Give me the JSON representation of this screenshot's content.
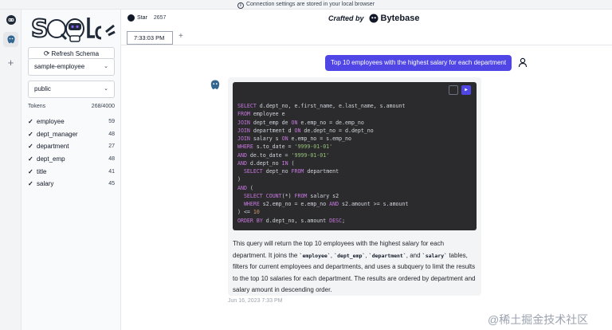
{
  "banner": {
    "text": "Connection settings are stored in your local browser",
    "icon": "info-icon"
  },
  "github": {
    "label": "Star",
    "count": "2657"
  },
  "header": {
    "crafted": "Crafted by",
    "brand": "Bytebase"
  },
  "tab": {
    "label": "7:33:03 PM",
    "add": "+"
  },
  "sidebar": {
    "refresh_label": "Refresh Schema",
    "database": "sample-employee",
    "schema": "public",
    "tokens_label": "Tokens",
    "tokens_value": "268/4000",
    "tables": [
      {
        "name": "employee",
        "count": "59"
      },
      {
        "name": "dept_manager",
        "count": "48"
      },
      {
        "name": "department",
        "count": "27"
      },
      {
        "name": "dept_emp",
        "count": "48"
      },
      {
        "name": "title",
        "count": "41"
      },
      {
        "name": "salary",
        "count": "45"
      }
    ]
  },
  "chat": {
    "user_message": "Top 10 employees with the highest salary for each department",
    "sql_lines": [
      "SELECT d.dept_no, e.first_name, e.last_name, s.amount",
      "FROM employee e",
      "JOIN dept_emp de ON e.emp_no = de.emp_no",
      "JOIN department d ON de.dept_no = d.dept_no",
      "JOIN salary s ON e.emp_no = s.emp_no",
      "WHERE s.to_date = '9999-01-01'",
      "AND de.to_date = '9999-01-01'",
      "AND d.dept_no IN (",
      "  SELECT dept_no FROM department",
      ")",
      "AND (",
      "  SELECT COUNT(*) FROM salary s2",
      "  WHERE s2.emp_no = e.emp_no AND s2.amount >= s.amount",
      ") <= 10",
      "ORDER BY d.dept_no, s.amount DESC;"
    ],
    "answer": {
      "p1": "This query will return the top 10 employees with the highest salary for each department. It joins the ",
      "t1": "`employee`",
      "s1": ", ",
      "t2": "`dept_emp`",
      "s2": ", ",
      "t3": "`department`",
      "s3": ", and ",
      "t4": "`salary`",
      "p2": " tables, filters for current employees and departments, and uses a subquery to limit the results to the top 10 salaries for each department. The results are ordered by department and salary amount in descending order."
    },
    "timestamp": "Jun 16, 2023 7:33 PM"
  },
  "watermark": "@稀土掘金技术社区",
  "colors": {
    "accent": "#4f46e5",
    "code_bg": "#2b2b2e"
  }
}
